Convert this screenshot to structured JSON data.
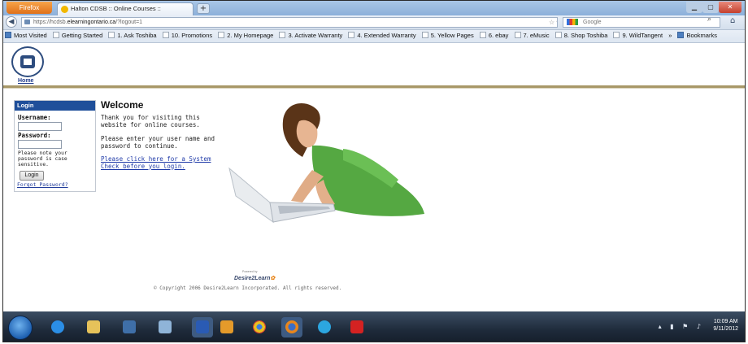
{
  "browser": {
    "app_button": "Firefox",
    "tab_title": "Halton CDSB :: Online Courses ::",
    "new_tab_symbol": "+",
    "url_prefix": "https://hcdsb.",
    "url_domain": "elearningontario.ca",
    "url_suffix": "/?logout=1",
    "search_placeholder": "Google",
    "bookmarks": [
      "Most Visited",
      "Getting Started",
      "1. Ask Toshiba",
      "10. Promotions",
      "2. My Homepage",
      "3. Activate Warranty",
      "4. Extended Warranty",
      "5. Yellow Pages",
      "6. ebay",
      "7. eMusic",
      "8. Shop Toshiba",
      "9. WildTangent",
      "»",
      "Bookmarks"
    ]
  },
  "header": {
    "home_link": "Home"
  },
  "login": {
    "heading": "Login",
    "username_label": "Username:",
    "password_label": "Password:",
    "note": "Please note your password is case sensitive.",
    "button": "Login",
    "forgot_link": "Forgot Password?"
  },
  "main": {
    "title": "Welcome",
    "para1": "Thank you for visiting this website for online courses.",
    "para2": "Please enter your user name and password to continue.",
    "system_check_link": "Please click here for a System Check before you login."
  },
  "footer": {
    "powered_by": "Powered by",
    "brand": "Desire2Learn",
    "copyright": "© Copyright 2006 Desire2Learn Incorporated. All rights reserved."
  },
  "taskbar": {
    "time": "10:09 AM",
    "date": "9/11/2012"
  },
  "colors": {
    "login_header": "#1f4f9a",
    "header_rule": "#a89868",
    "link": "#1f3aa8"
  }
}
